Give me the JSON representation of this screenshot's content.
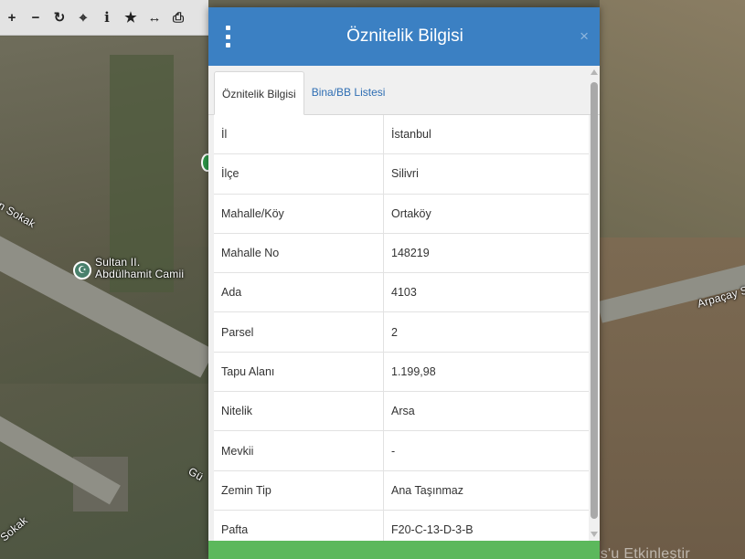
{
  "map": {
    "labels": {
      "sokak_left": "n Sokak",
      "poi": "Sultan II. Abdülhamit Camii",
      "road_right": "Arpaçay S",
      "road_bottom": "Gü",
      "sokak_bottom_left": "Sokak"
    },
    "os_watermark": "Windows'u Etkinleştir"
  },
  "toolbar": {
    "tools": [
      {
        "icon": "plus-icon",
        "glyph": "+"
      },
      {
        "icon": "minus-icon",
        "glyph": "−"
      },
      {
        "icon": "refresh-icon",
        "glyph": "↻"
      },
      {
        "icon": "crosshair-icon",
        "glyph": "⌖"
      },
      {
        "icon": "info-icon",
        "glyph": "i"
      },
      {
        "icon": "star-icon",
        "glyph": "★"
      },
      {
        "icon": "measure-icon",
        "glyph": "↔"
      },
      {
        "icon": "print-icon",
        "glyph": "⎙"
      }
    ]
  },
  "modal": {
    "title": "Öznitelik Bilgisi",
    "close_glyph": "×",
    "tabs": [
      {
        "label": "Öznitelik Bilgisi",
        "active": true
      },
      {
        "label": "Bina/BB Listesi",
        "active": false
      }
    ],
    "rows": [
      {
        "key": "İl",
        "value": "İstanbul"
      },
      {
        "key": "İlçe",
        "value": "Silivri"
      },
      {
        "key": "Mahalle/Köy",
        "value": "Ortaköy"
      },
      {
        "key": "Mahalle No",
        "value": "148219"
      },
      {
        "key": "Ada",
        "value": "4103"
      },
      {
        "key": "Parsel",
        "value": "2"
      },
      {
        "key": "Tapu Alanı",
        "value": "1.199,98"
      },
      {
        "key": "Nitelik",
        "value": "Arsa"
      },
      {
        "key": "Mevkii",
        "value": "-"
      },
      {
        "key": "Zemin Tip",
        "value": "Ana Taşınmaz"
      },
      {
        "key": "Pafta",
        "value": "F20-C-13-D-3-B"
      }
    ]
  },
  "colors": {
    "header": "#3b80c3",
    "footer": "#5cb85c",
    "link": "#2f6eb3"
  }
}
